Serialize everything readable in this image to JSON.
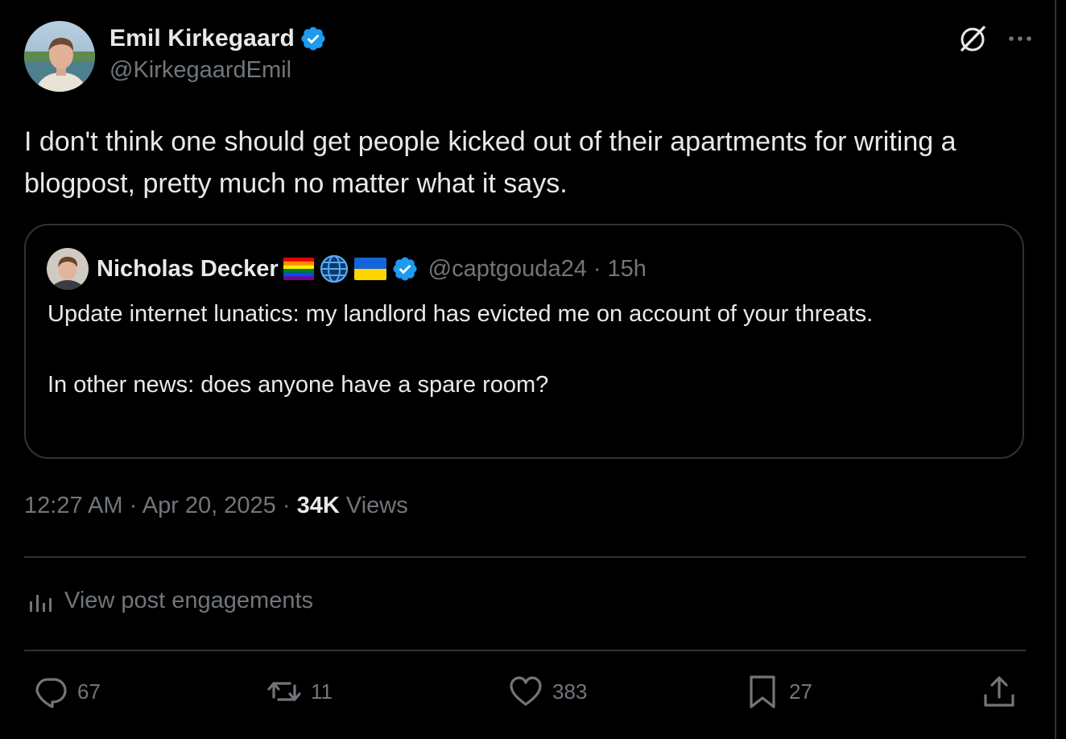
{
  "author": {
    "name": "Emil Kirkegaard",
    "handle": "@KirkegaardEmil",
    "verified": true
  },
  "tweet": {
    "text": "I don't think one should get people kicked out of their apartments for writing a blogpost, pretty much no matter what it says."
  },
  "quoted": {
    "name": "Nicholas Decker",
    "flags": [
      "rainbow-flag",
      "globe-icon",
      "ukraine-flag"
    ],
    "handle": "@captgouda24",
    "separator": "·",
    "age": "15h",
    "text": "Update internet lunatics: my landlord has evicted me on account of your threats.\n\nIn other news: does anyone have a spare room?"
  },
  "meta": {
    "time": "12:27 AM",
    "sep1": "·",
    "date": "Apr 20, 2025",
    "sep2": "·",
    "views_count": "34K",
    "views_label": "Views"
  },
  "engagements": {
    "label": "View post engagements"
  },
  "actions": {
    "replies": "67",
    "reposts": "11",
    "likes": "383",
    "bookmarks": "27"
  },
  "colors": {
    "background": "#000000",
    "text": "#e7e9ea",
    "secondary": "#71767b",
    "border": "#2f3336",
    "verified": "#1d9bf0"
  },
  "icons": [
    "verified-badge-icon",
    "grok-icon",
    "more-icon",
    "engagements-icon",
    "reply-icon",
    "repost-icon",
    "like-icon",
    "bookmark-icon",
    "share-icon"
  ]
}
